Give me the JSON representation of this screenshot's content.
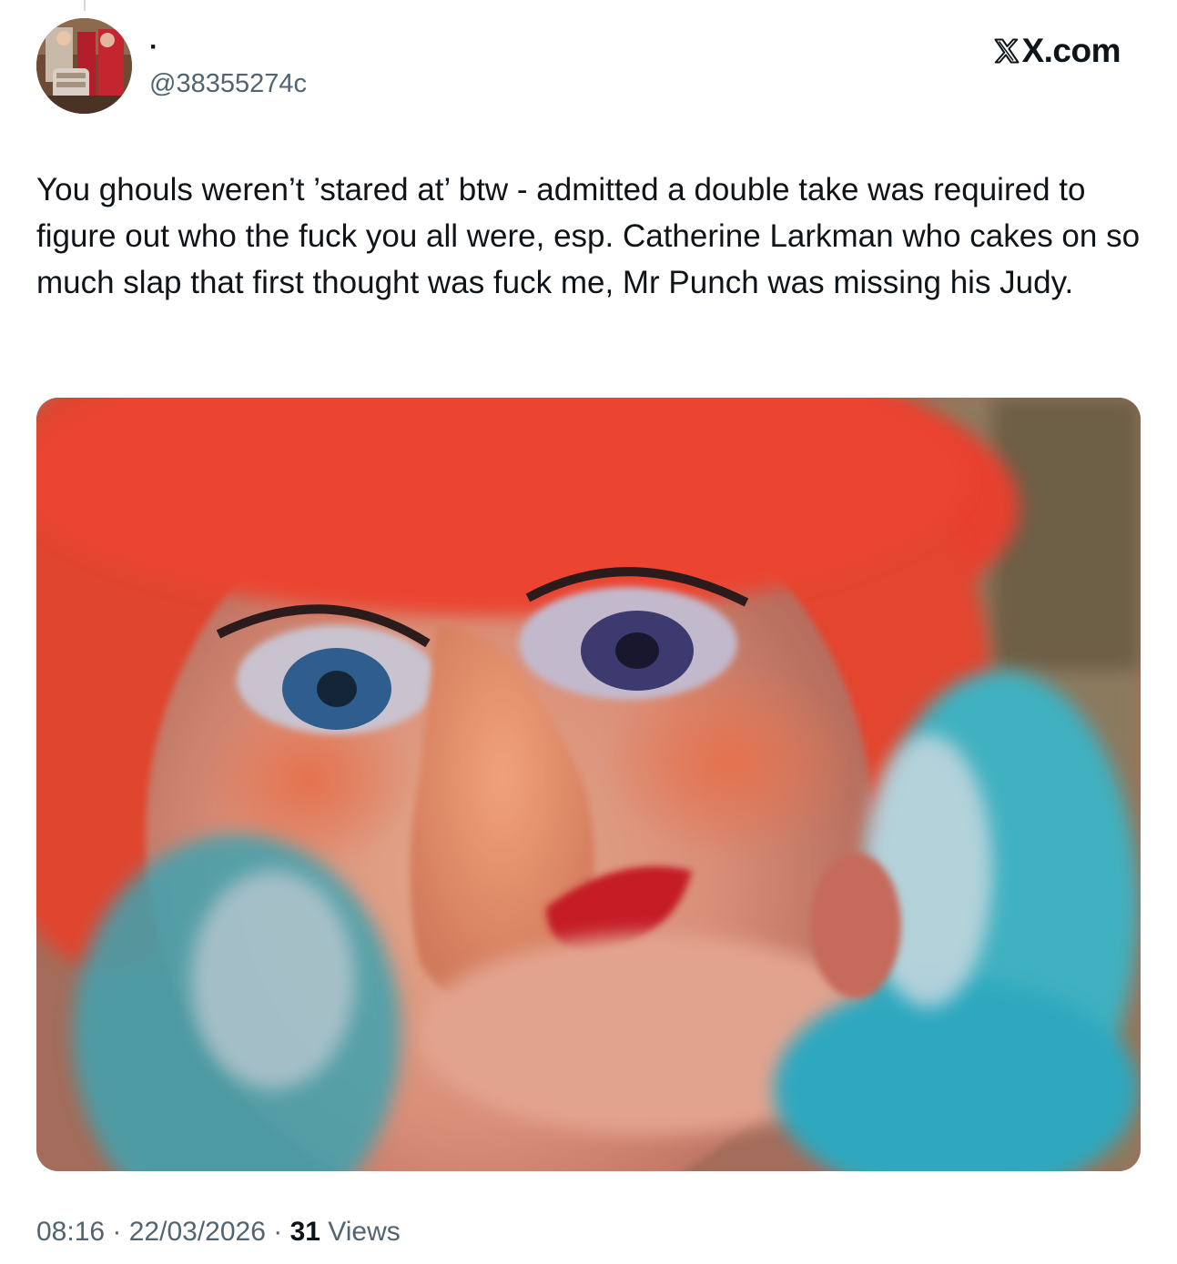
{
  "author": {
    "display_name": "·",
    "handle": "@38355274c"
  },
  "brand": {
    "label": "X.com"
  },
  "tweet": {
    "text": "You ghouls weren’t ’stared at’ btw - admitted a double take was required to figure out who the fuck you all were, esp. Catherine Larkman who cakes on so much slap that first thought was fuck me, Mr Punch was missing his Judy."
  },
  "meta": {
    "time": "08:16",
    "separator": " · ",
    "date": "22/03/2026",
    "views_count": "31",
    "views_label": "Views"
  },
  "colors": {
    "text_primary": "#0f1419",
    "text_secondary": "#536471",
    "background": "#ffffff"
  },
  "icons": {
    "brand_logo": "x-logo-icon",
    "avatar": "profile-photo"
  },
  "media": {
    "kind": "photo"
  }
}
